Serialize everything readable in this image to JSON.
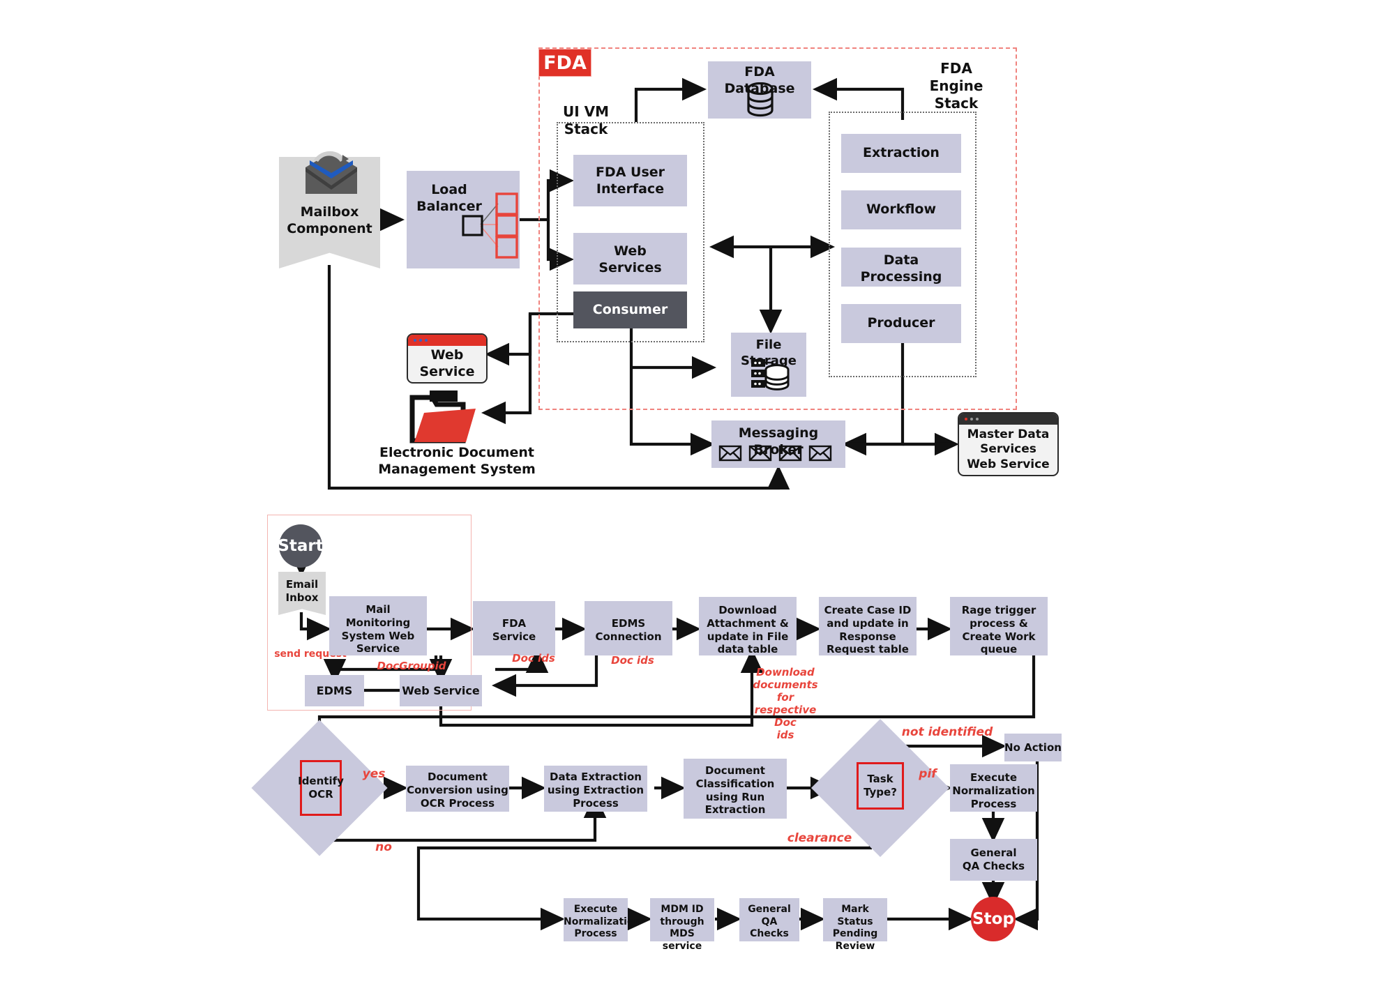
{
  "architecture": {
    "boundary_label": "FDA",
    "groups": {
      "ui_vm_stack": "UI VM\nStack",
      "ui_vm_stack_line1": "UI VM",
      "ui_vm_stack_line2": "Stack",
      "engine_stack_line1": "FDA",
      "engine_stack_line2": "Engine",
      "engine_stack_line3": "Stack"
    },
    "nodes": {
      "mailbox": "Mailbox\nComponent",
      "mailbox_l1": "Mailbox",
      "mailbox_l2": "Component",
      "load_balancer_l1": "Load",
      "load_balancer_l2": "Balancer",
      "fda_user_interface_l1": "FDA User",
      "fda_user_interface_l2": "Interface",
      "web_services_l1": "Web",
      "web_services_l2": "Services",
      "consumer": "Consumer",
      "fda_database": "FDA Database",
      "file_storage": "File Storage",
      "extraction": "Extraction",
      "workflow": "Workflow",
      "data_processing_l1": "Data",
      "data_processing_l2": "Processing",
      "producer": "Producer",
      "web_service_l1": "Web",
      "web_service_l2": "Service",
      "edms_caption_l1": "Electronic Document",
      "edms_caption_l2": "Management System",
      "messaging_broker": "Messaging Broker",
      "mds_l1": "Master Data",
      "mds_l2": "Services",
      "mds_l3": "Web Service"
    }
  },
  "flowchart": {
    "start": "Start",
    "stop": "Stop",
    "nodes": {
      "email_inbox_l1": "Email",
      "email_inbox_l2": "Inbox",
      "mail_monitoring_l1": "Mail",
      "mail_monitoring_l2": "Monitoring",
      "mail_monitoring_l3": "System Web",
      "mail_monitoring_l4": "Service",
      "fda_service_l1": "FDA",
      "fda_service_l2": "Service",
      "edms_connection_l1": "EDMS",
      "edms_connection_l2": "Connection",
      "download_attachment_l1": "Download",
      "download_attachment_l2": "Attachment &",
      "download_attachment_l3": "update in File",
      "download_attachment_l4": "data table",
      "create_case_id_l1": "Create Case ID",
      "create_case_id_l2": "and update in",
      "create_case_id_l3": "Response",
      "create_case_id_l4": "Request table",
      "rage_trigger_l1": "Rage trigger",
      "rage_trigger_l2": "process &",
      "rage_trigger_l3": "Create Work",
      "rage_trigger_l4": "queue",
      "edms": "EDMS",
      "web_service": "Web Service",
      "identify_ocr_l1": "Identify",
      "identify_ocr_l2": "OCR",
      "doc_conversion_l1": "Document",
      "doc_conversion_l2": "Conversion using",
      "doc_conversion_l3": "OCR Process",
      "data_extraction_l1": "Data Extraction",
      "data_extraction_l2": "using Extraction",
      "data_extraction_l3": "Process",
      "doc_classification_l1": "Document",
      "doc_classification_l2": "Classification",
      "doc_classification_l3": "using Run",
      "doc_classification_l4": "Extraction",
      "task_type_l1": "Task",
      "task_type_l2": "Type?",
      "no_action": "No Action",
      "exec_norm_top_l1": "Execute",
      "exec_norm_top_l2": "Normalization",
      "exec_norm_top_l3": "Process",
      "general_qa_top_l1": "General",
      "general_qa_top_l2": "QA Checks",
      "exec_norm_bot_l1": "Execute",
      "exec_norm_bot_l2": "Normalization",
      "exec_norm_bot_l3": "Process",
      "mdm_id_l1": "MDM ID",
      "mdm_id_l2": "through MDS",
      "mdm_id_l3": "service",
      "general_qa_bot_l1": "General",
      "general_qa_bot_l2": "QA",
      "general_qa_bot_l3": "Checks",
      "mark_status_l1": "Mark Status",
      "mark_status_l2": "Pending",
      "mark_status_l3": "Review"
    },
    "edge_labels": {
      "send_request": "send request",
      "doc_groupid": "DocGroupid",
      "doc_ids_1": "Doc ids",
      "doc_ids_2": "Doc ids",
      "download_docs_l1": "Download",
      "download_docs_l2": "documents for",
      "download_docs_l3": "respective Doc",
      "download_docs_l4": "ids",
      "yes": "yes",
      "no": "no",
      "not_identified": "not identified",
      "pif": "pif",
      "clearance": "clearance"
    }
  },
  "colors": {
    "lavender": "#c9c9dd",
    "grey": "#d8d8d8",
    "dark_slate": "#53555e",
    "accent_red": "#e03127",
    "stop_red": "#d92b2b",
    "boundary_pink": "#f0837e",
    "edge_label_red": "#e8453c"
  }
}
